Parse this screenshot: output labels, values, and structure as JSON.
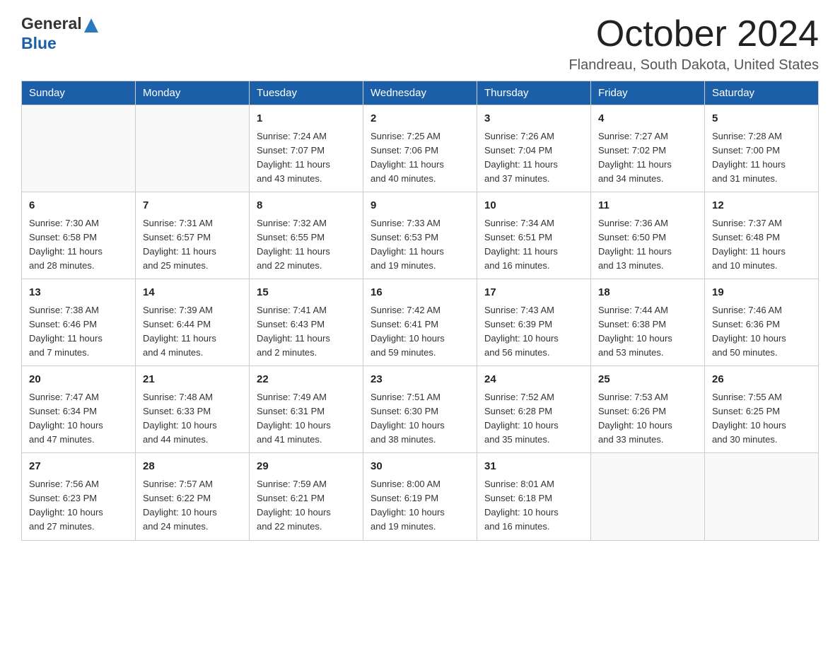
{
  "header": {
    "logo_line1": "General",
    "logo_line2": "Blue",
    "title": "October 2024",
    "subtitle": "Flandreau, South Dakota, United States"
  },
  "calendar": {
    "headers": [
      "Sunday",
      "Monday",
      "Tuesday",
      "Wednesday",
      "Thursday",
      "Friday",
      "Saturday"
    ],
    "weeks": [
      [
        {
          "day": "",
          "info": ""
        },
        {
          "day": "",
          "info": ""
        },
        {
          "day": "1",
          "info": "Sunrise: 7:24 AM\nSunset: 7:07 PM\nDaylight: 11 hours\nand 43 minutes."
        },
        {
          "day": "2",
          "info": "Sunrise: 7:25 AM\nSunset: 7:06 PM\nDaylight: 11 hours\nand 40 minutes."
        },
        {
          "day": "3",
          "info": "Sunrise: 7:26 AM\nSunset: 7:04 PM\nDaylight: 11 hours\nand 37 minutes."
        },
        {
          "day": "4",
          "info": "Sunrise: 7:27 AM\nSunset: 7:02 PM\nDaylight: 11 hours\nand 34 minutes."
        },
        {
          "day": "5",
          "info": "Sunrise: 7:28 AM\nSunset: 7:00 PM\nDaylight: 11 hours\nand 31 minutes."
        }
      ],
      [
        {
          "day": "6",
          "info": "Sunrise: 7:30 AM\nSunset: 6:58 PM\nDaylight: 11 hours\nand 28 minutes."
        },
        {
          "day": "7",
          "info": "Sunrise: 7:31 AM\nSunset: 6:57 PM\nDaylight: 11 hours\nand 25 minutes."
        },
        {
          "day": "8",
          "info": "Sunrise: 7:32 AM\nSunset: 6:55 PM\nDaylight: 11 hours\nand 22 minutes."
        },
        {
          "day": "9",
          "info": "Sunrise: 7:33 AM\nSunset: 6:53 PM\nDaylight: 11 hours\nand 19 minutes."
        },
        {
          "day": "10",
          "info": "Sunrise: 7:34 AM\nSunset: 6:51 PM\nDaylight: 11 hours\nand 16 minutes."
        },
        {
          "day": "11",
          "info": "Sunrise: 7:36 AM\nSunset: 6:50 PM\nDaylight: 11 hours\nand 13 minutes."
        },
        {
          "day": "12",
          "info": "Sunrise: 7:37 AM\nSunset: 6:48 PM\nDaylight: 11 hours\nand 10 minutes."
        }
      ],
      [
        {
          "day": "13",
          "info": "Sunrise: 7:38 AM\nSunset: 6:46 PM\nDaylight: 11 hours\nand 7 minutes."
        },
        {
          "day": "14",
          "info": "Sunrise: 7:39 AM\nSunset: 6:44 PM\nDaylight: 11 hours\nand 4 minutes."
        },
        {
          "day": "15",
          "info": "Sunrise: 7:41 AM\nSunset: 6:43 PM\nDaylight: 11 hours\nand 2 minutes."
        },
        {
          "day": "16",
          "info": "Sunrise: 7:42 AM\nSunset: 6:41 PM\nDaylight: 10 hours\nand 59 minutes."
        },
        {
          "day": "17",
          "info": "Sunrise: 7:43 AM\nSunset: 6:39 PM\nDaylight: 10 hours\nand 56 minutes."
        },
        {
          "day": "18",
          "info": "Sunrise: 7:44 AM\nSunset: 6:38 PM\nDaylight: 10 hours\nand 53 minutes."
        },
        {
          "day": "19",
          "info": "Sunrise: 7:46 AM\nSunset: 6:36 PM\nDaylight: 10 hours\nand 50 minutes."
        }
      ],
      [
        {
          "day": "20",
          "info": "Sunrise: 7:47 AM\nSunset: 6:34 PM\nDaylight: 10 hours\nand 47 minutes."
        },
        {
          "day": "21",
          "info": "Sunrise: 7:48 AM\nSunset: 6:33 PM\nDaylight: 10 hours\nand 44 minutes."
        },
        {
          "day": "22",
          "info": "Sunrise: 7:49 AM\nSunset: 6:31 PM\nDaylight: 10 hours\nand 41 minutes."
        },
        {
          "day": "23",
          "info": "Sunrise: 7:51 AM\nSunset: 6:30 PM\nDaylight: 10 hours\nand 38 minutes."
        },
        {
          "day": "24",
          "info": "Sunrise: 7:52 AM\nSunset: 6:28 PM\nDaylight: 10 hours\nand 35 minutes."
        },
        {
          "day": "25",
          "info": "Sunrise: 7:53 AM\nSunset: 6:26 PM\nDaylight: 10 hours\nand 33 minutes."
        },
        {
          "day": "26",
          "info": "Sunrise: 7:55 AM\nSunset: 6:25 PM\nDaylight: 10 hours\nand 30 minutes."
        }
      ],
      [
        {
          "day": "27",
          "info": "Sunrise: 7:56 AM\nSunset: 6:23 PM\nDaylight: 10 hours\nand 27 minutes."
        },
        {
          "day": "28",
          "info": "Sunrise: 7:57 AM\nSunset: 6:22 PM\nDaylight: 10 hours\nand 24 minutes."
        },
        {
          "day": "29",
          "info": "Sunrise: 7:59 AM\nSunset: 6:21 PM\nDaylight: 10 hours\nand 22 minutes."
        },
        {
          "day": "30",
          "info": "Sunrise: 8:00 AM\nSunset: 6:19 PM\nDaylight: 10 hours\nand 19 minutes."
        },
        {
          "day": "31",
          "info": "Sunrise: 8:01 AM\nSunset: 6:18 PM\nDaylight: 10 hours\nand 16 minutes."
        },
        {
          "day": "",
          "info": ""
        },
        {
          "day": "",
          "info": ""
        }
      ]
    ]
  }
}
